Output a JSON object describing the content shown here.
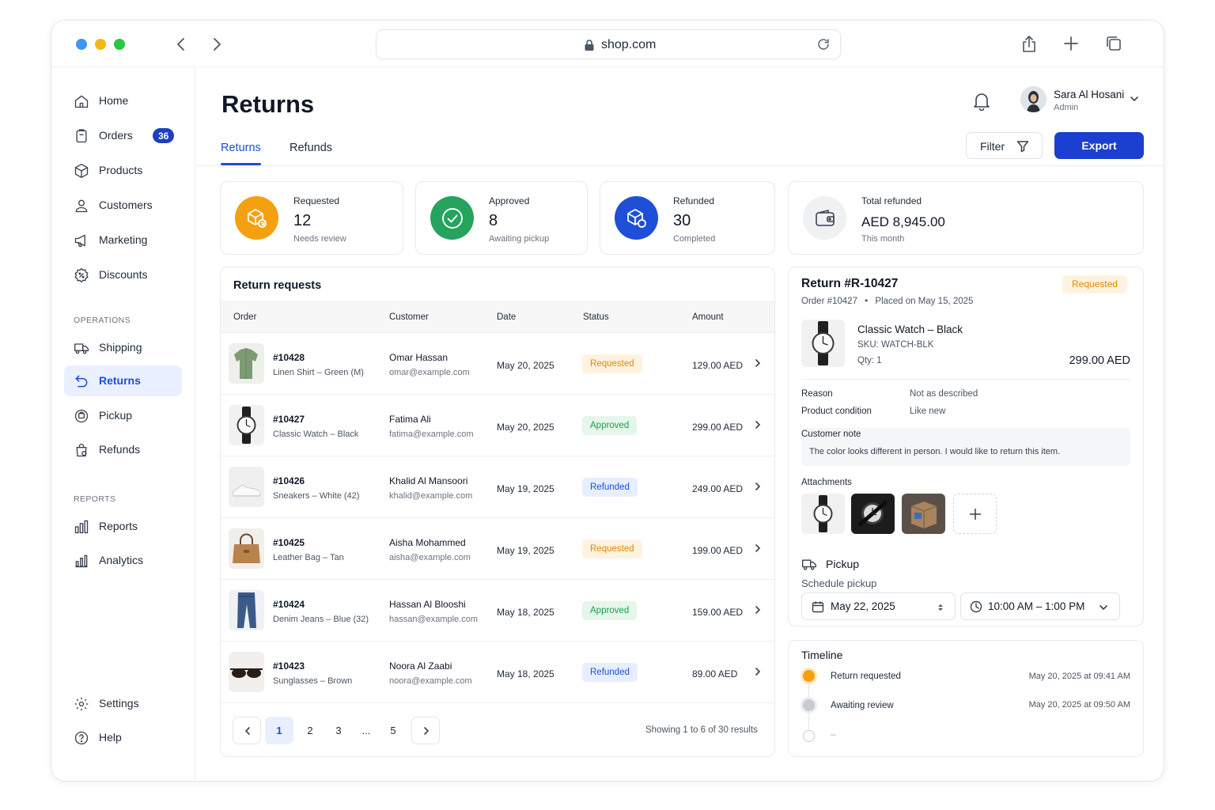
{
  "browser": {
    "url": "shop.com"
  },
  "colors": {
    "accent": "#1b3fd0",
    "requested": "#e08600",
    "approved": "#1f9d48",
    "refunded": "#1d4ed8",
    "orange": "#f5a00f",
    "green": "#26a35c",
    "blue": "#1e4fd6"
  },
  "sidebar": {
    "items": [
      {
        "label": "Home",
        "icon": "home-icon"
      },
      {
        "label": "Orders",
        "icon": "clipboard-icon",
        "badge": "36"
      },
      {
        "label": "Products",
        "icon": "box-icon"
      },
      {
        "label": "Customers",
        "icon": "user-icon"
      },
      {
        "label": "Marketing",
        "icon": "megaphone-icon"
      },
      {
        "label": "Discounts",
        "icon": "discount-icon"
      }
    ],
    "operations_label": "OPERATIONS",
    "operations": [
      {
        "label": "Shipping",
        "icon": "truck-icon"
      },
      {
        "label": "Returns",
        "icon": "return-icon",
        "active": true
      },
      {
        "label": "Pickup",
        "icon": "pickup-icon"
      },
      {
        "label": "Refunds",
        "icon": "refund-bag-icon"
      }
    ],
    "reports_label": "REPORTS",
    "reports": [
      {
        "label": "Reports",
        "icon": "bar-chart-icon"
      },
      {
        "label": "Analytics",
        "icon": "analytics-icon"
      }
    ],
    "bottom": [
      {
        "label": "Settings",
        "icon": "gear-icon"
      },
      {
        "label": "Help",
        "icon": "help-icon"
      }
    ]
  },
  "header": {
    "title": "Returns",
    "tabs": [
      "Returns",
      "Refunds"
    ],
    "user_name": "Sara Al Hosani",
    "user_role": "Admin",
    "filter_label": "Filter",
    "export_label": "Export"
  },
  "stats": [
    {
      "label": "Requested",
      "value": "12",
      "sub": "Needs review",
      "icon": "return-box-icon"
    },
    {
      "label": "Approved",
      "value": "8",
      "sub": "Awaiting pickup",
      "icon": "check-circle-icon"
    },
    {
      "label": "Refunded",
      "value": "30",
      "sub": "Completed",
      "icon": "refund-box-icon"
    },
    {
      "label": "Total refunded",
      "value": "AED 8,945.00",
      "sub": "This month",
      "icon": "wallet-icon"
    }
  ],
  "table": {
    "title": "Return requests",
    "columns": [
      "Order",
      "Customer",
      "Date",
      "Status",
      "Amount"
    ],
    "rows": [
      {
        "order": "#10428",
        "product": "Linen Shirt – Green (M)",
        "customer": "Omar Hassan",
        "email": "omar@example.com",
        "date": "May 20, 2025",
        "status": "Requested",
        "amount": "129.00 AED",
        "thumb": "shirt"
      },
      {
        "order": "#10427",
        "product": "Classic Watch – Black",
        "customer": "Fatima Ali",
        "email": "fatima@example.com",
        "date": "May 20, 2025",
        "status": "Approved",
        "amount": "299.00 AED",
        "thumb": "watch"
      },
      {
        "order": "#10426",
        "product": "Sneakers – White (42)",
        "customer": "Khalid Al Mansoori",
        "email": "khalid@example.com",
        "date": "May 19, 2025",
        "status": "Refunded",
        "amount": "249.00 AED",
        "thumb": "sneaker"
      },
      {
        "order": "#10425",
        "product": "Leather Bag – Tan",
        "customer": "Aisha Mohammed",
        "email": "aisha@example.com",
        "date": "May 19, 2025",
        "status": "Requested",
        "amount": "199.00 AED",
        "thumb": "bag"
      },
      {
        "order": "#10424",
        "product": "Denim Jeans – Blue (32)",
        "customer": "Hassan Al Blooshi",
        "email": "hassan@example.com",
        "date": "May 18, 2025",
        "status": "Approved",
        "amount": "159.00 AED",
        "thumb": "jeans"
      },
      {
        "order": "#10423",
        "product": "Sunglasses – Brown",
        "customer": "Noora Al Zaabi",
        "email": "noora@example.com",
        "date": "May 18, 2025",
        "status": "Refunded",
        "amount": "89.00 AED",
        "thumb": "sunglasses"
      }
    ],
    "pages": [
      "1",
      "2",
      "3",
      "...",
      "5"
    ],
    "current_page": "1",
    "showing": "Showing 1 to 6 of 30 results"
  },
  "detail": {
    "title": "Return #R-10427",
    "status": "Requested",
    "order": "Order #10427",
    "placed": "Placed on May 15, 2025",
    "product": "Classic Watch – Black",
    "sku": "SKU: WATCH-BLK",
    "qty": "Qty: 1",
    "price": "299.00 AED",
    "reason_label": "Reason",
    "reason": "Not as described",
    "condition_label": "Product condition",
    "condition": "Like new",
    "note_label": "Customer note",
    "note": "The color looks different in person. I would like to return this item.",
    "attachments_label": "Attachments",
    "pickup_title": "Pickup",
    "pickup_sub": "Schedule pickup",
    "pickup_date": "May 22, 2025",
    "pickup_time": "10:00 AM – 1:00 PM"
  },
  "timeline": {
    "title": "Timeline",
    "events": [
      {
        "text": "Return requested",
        "time": "May 20, 2025 at 09:41 AM",
        "state": "done"
      },
      {
        "text": "Awaiting review",
        "time": "May 20, 2025 at 09:50 AM",
        "state": "current"
      },
      {
        "text": "–",
        "time": "",
        "state": "pending"
      }
    ]
  }
}
